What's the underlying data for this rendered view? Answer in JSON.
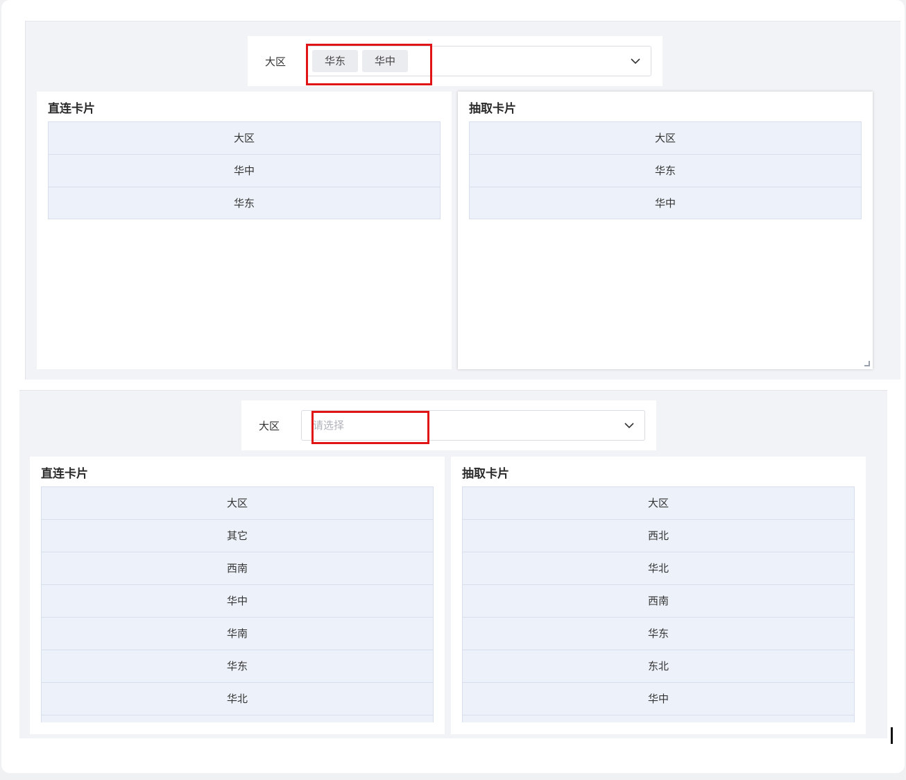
{
  "top": {
    "filter": {
      "label": "大区",
      "tags": [
        "华东",
        "华中"
      ]
    },
    "cards": [
      {
        "title": "直连卡片",
        "rows": [
          "大区",
          "华中",
          "华东"
        ]
      },
      {
        "title": "抽取卡片",
        "rows": [
          "大区",
          "华东",
          "华中"
        ]
      }
    ]
  },
  "bottom": {
    "filter": {
      "label": "大区",
      "placeholder": "请选择"
    },
    "cards": [
      {
        "title": "直连卡片",
        "rows": [
          "大区",
          "其它",
          "西南",
          "华中",
          "华南",
          "华东",
          "华北"
        ]
      },
      {
        "title": "抽取卡片",
        "rows": [
          "大区",
          "西北",
          "华北",
          "西南",
          "华东",
          "东北",
          "华中"
        ]
      }
    ]
  },
  "colors": {
    "highlight": "#e01414",
    "row_bg": "#edf2fa"
  },
  "icons": {
    "dropdown": "chevron-down-icon",
    "resize": "resize-corner-icon"
  }
}
